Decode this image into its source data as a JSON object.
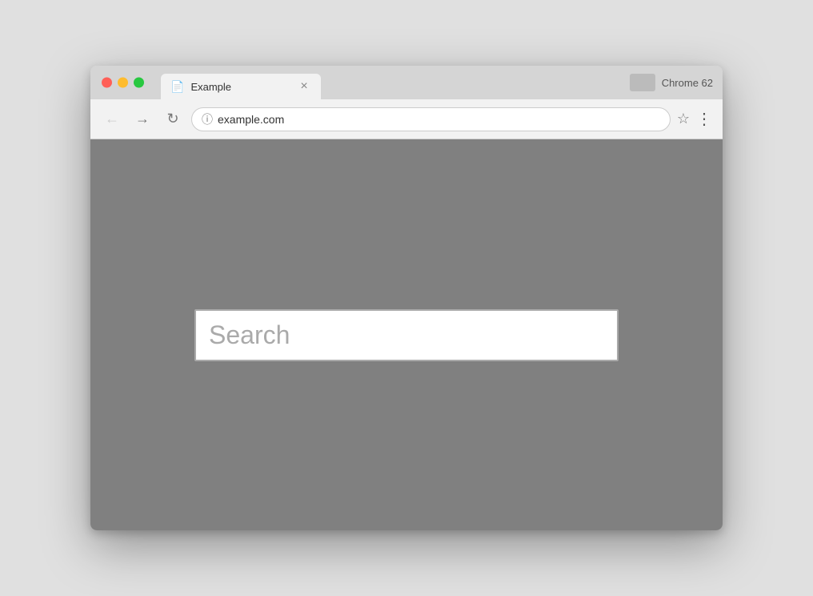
{
  "browser": {
    "title": "Example",
    "url": "example.com",
    "chrome_label": "Chrome 62",
    "tab_close": "×",
    "nav": {
      "back": "←",
      "forward": "→",
      "reload": "↻"
    },
    "toolbar": {
      "bookmark_icon": "☆",
      "menu_icon": "⋮"
    }
  },
  "page": {
    "search_placeholder": "Search"
  }
}
